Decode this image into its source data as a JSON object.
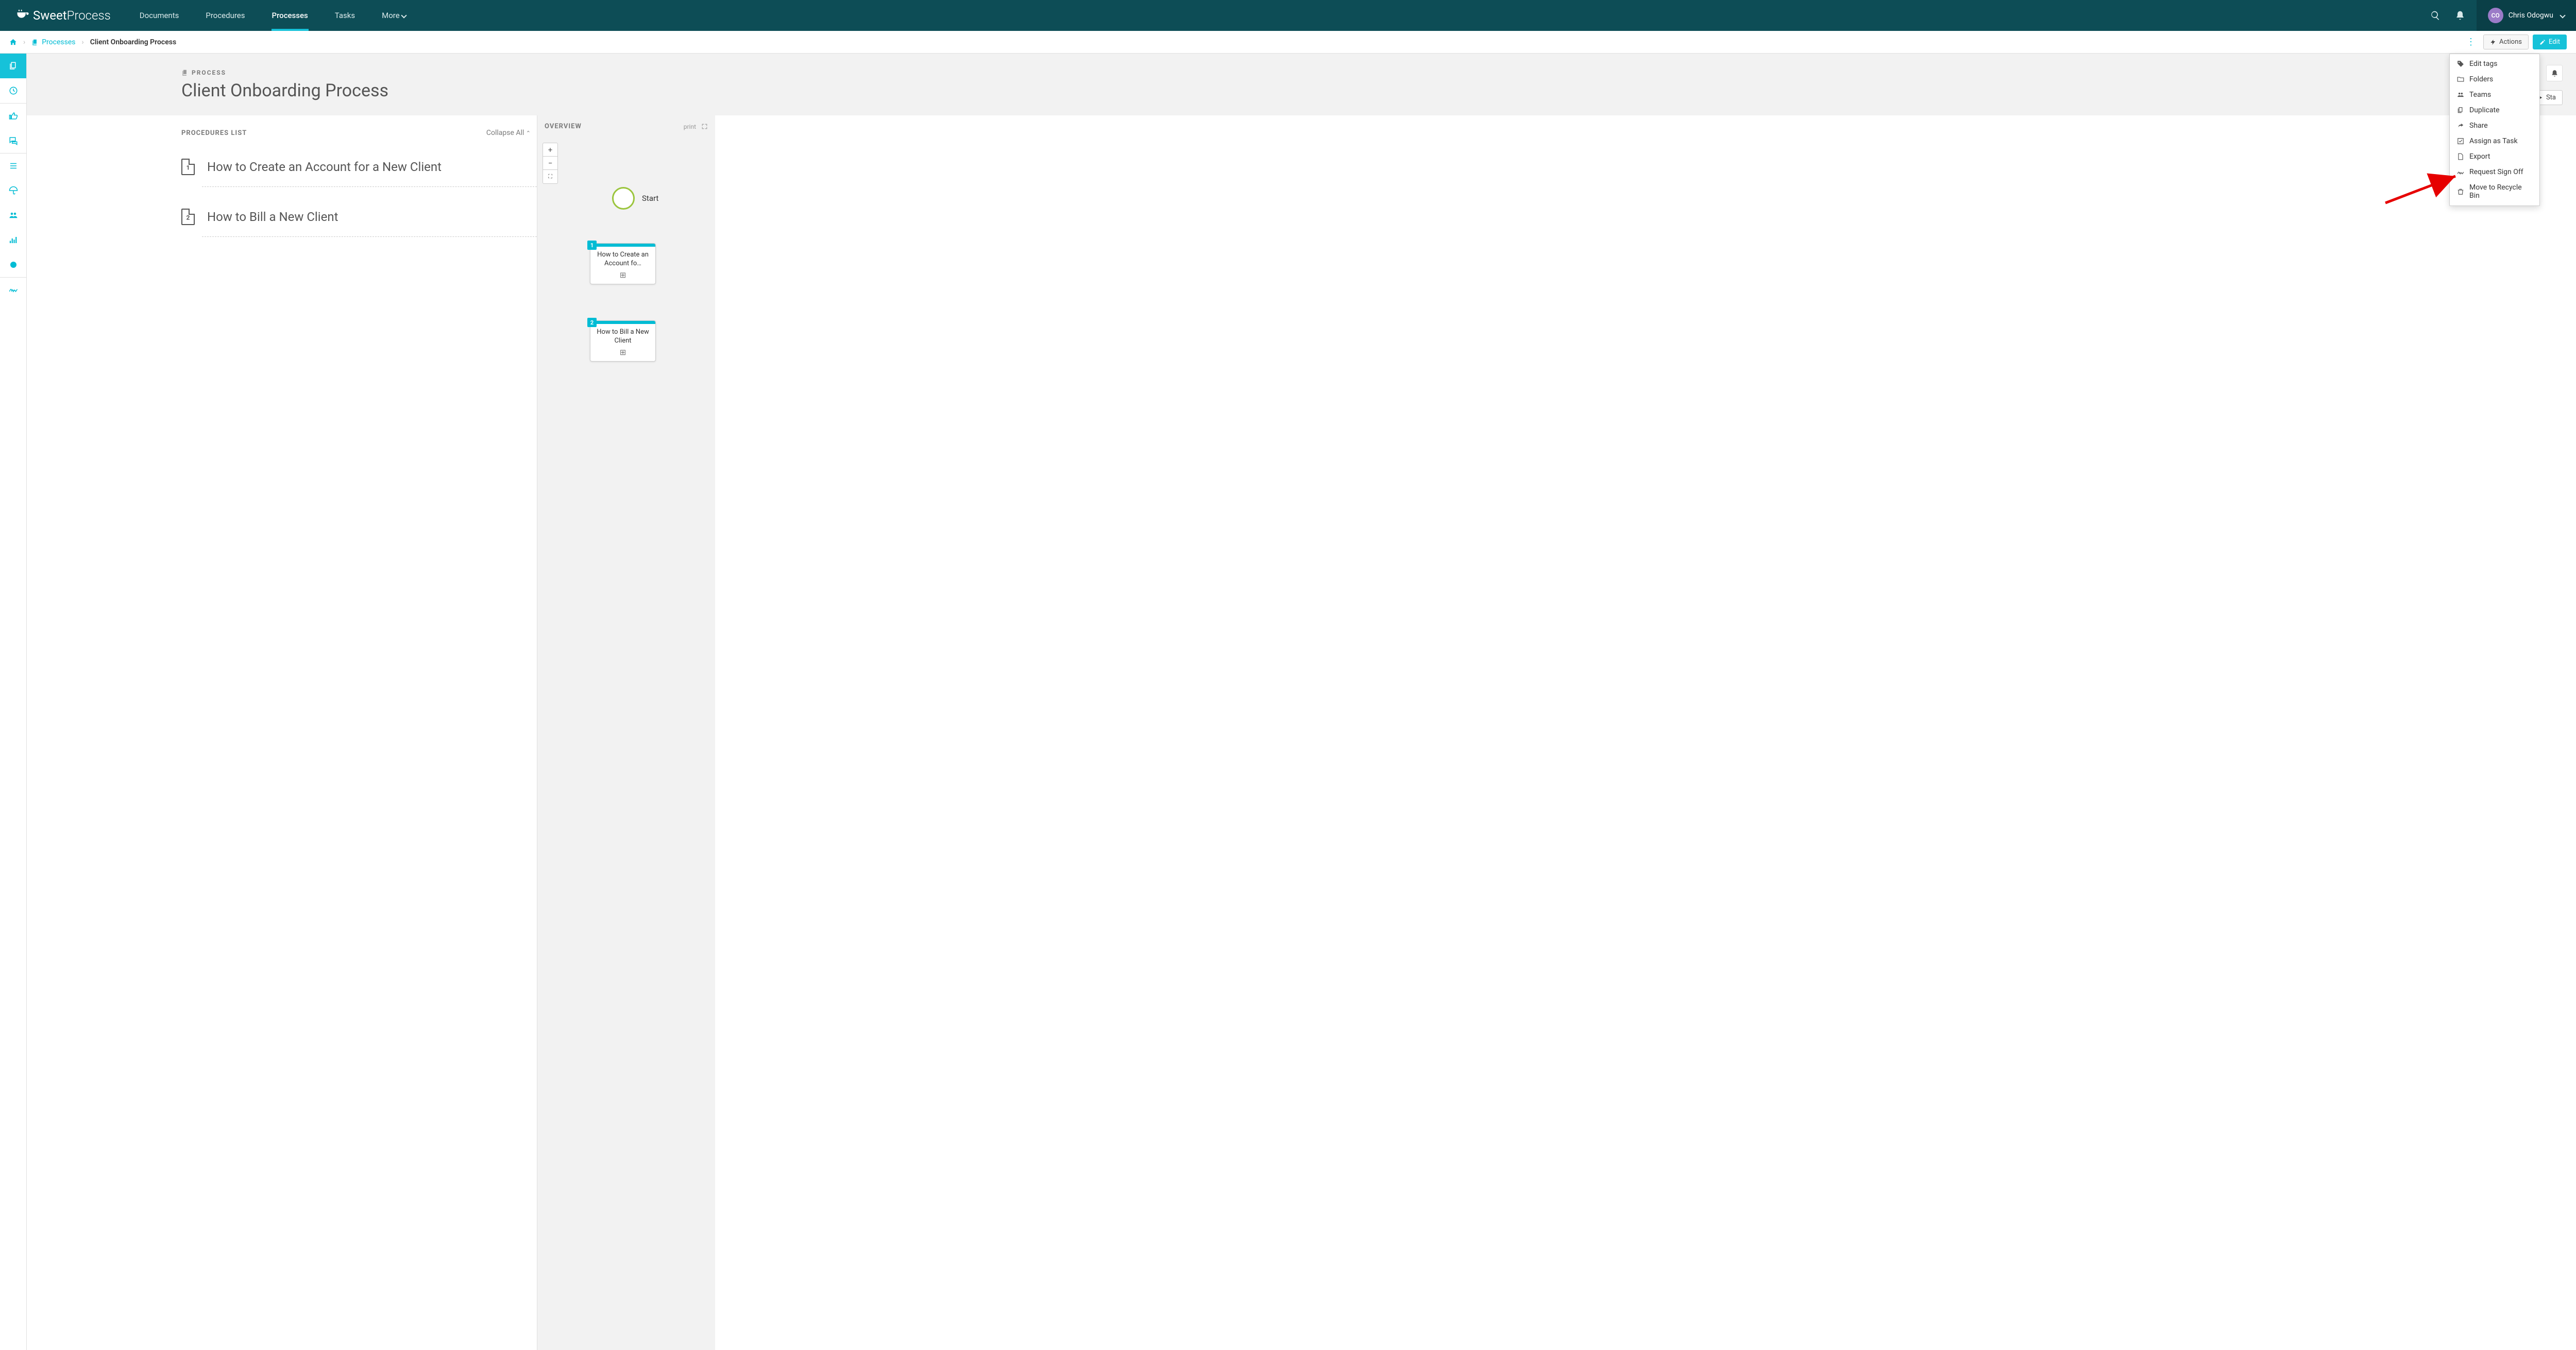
{
  "brand": {
    "name_first": "Sweet",
    "name_second": "Process"
  },
  "topnav": {
    "documents": "Documents",
    "procedures": "Procedures",
    "processes": "Processes",
    "tasks": "Tasks",
    "more": "More"
  },
  "user": {
    "initials": "CO",
    "name": "Chris Odogwu"
  },
  "breadcrumb": {
    "processes": "Processes",
    "current": "Client Onboarding Process"
  },
  "actions_btn": "Actions",
  "edit_btn": "Edit",
  "hero": {
    "label": "PROCESS",
    "title": "Client Onboarding Process",
    "start": "Sta"
  },
  "procedures_list_label": "PROCEDURES LIST",
  "collapse_all": "Collapse All",
  "procedures": [
    {
      "num": "1",
      "title": "How to Create an Account for a New Client"
    },
    {
      "num": "2",
      "title": "How to Bill a New Client"
    }
  ],
  "overview_label": "OVERVIEW",
  "overview_tools": {
    "print": "print"
  },
  "flow": {
    "start": "Start",
    "nodes": [
      {
        "badge": "1",
        "title": "How to Create an Account fo…"
      },
      {
        "badge": "2",
        "title": "How to Bill a New Client"
      }
    ]
  },
  "dropdown": [
    {
      "icon": "tag",
      "label": "Edit tags"
    },
    {
      "icon": "folder",
      "label": "Folders"
    },
    {
      "icon": "teams",
      "label": "Teams"
    },
    {
      "icon": "duplicate",
      "label": "Duplicate"
    },
    {
      "icon": "share",
      "label": "Share"
    },
    {
      "icon": "check",
      "label": "Assign as Task"
    },
    {
      "icon": "file",
      "label": "Export"
    },
    {
      "icon": "sign",
      "label": "Request Sign Off"
    },
    {
      "icon": "trash",
      "label": "Move to Recycle Bin"
    }
  ]
}
